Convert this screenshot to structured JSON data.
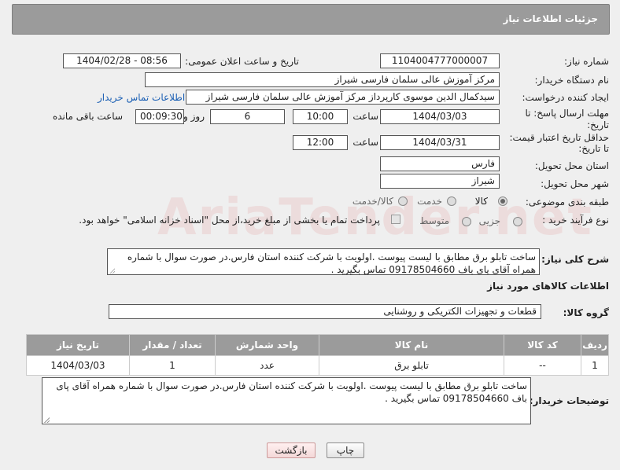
{
  "header": {
    "title": "جزئیات اطلاعات نیاز"
  },
  "form": {
    "need_number_label": "شماره نیاز:",
    "need_number": "1104004777000007",
    "announce_label": "تاریخ و ساعت اعلان عمومی:",
    "announce_value": "1404/02/28 - 08:56",
    "buyer_org_label": "نام دستگاه خریدار:",
    "buyer_org": "مرکز آموزش عالی سلمان فارسی شیراز",
    "creator_label": "ایجاد کننده درخواست:",
    "creator": "سیدکمال الدین موسوی کارپرداز مرکز آموزش عالی سلمان فارسی شیراز",
    "contact_link": "اطلاعات تماس خریدار",
    "deadline_label_1": "مهلت ارسال پاسخ: تا",
    "deadline_label_2": "تاریخ:",
    "deadline_date": "1404/03/03",
    "time_label": "ساعت",
    "deadline_time": "10:00",
    "days": "6",
    "days_label": "روز و",
    "remaining": "00:09:30",
    "remaining_label": "ساعت باقی مانده",
    "validity_label_1": "حداقل تاریخ اعتبار قیمت:",
    "validity_label_2": "تا تاریخ:",
    "validity_date": "1404/03/31",
    "validity_time": "12:00",
    "province_label": "استان محل تحویل:",
    "province": "فارس",
    "city_label": "شهر محل تحویل:",
    "city": "شیراز",
    "category_label": "طبقه بندی موضوعی:",
    "category_options": [
      "کالا",
      "خدمت",
      "کالا/خدمت"
    ],
    "process_label": "نوع فرآیند خرید :",
    "process_options": [
      "جزیی",
      "متوسط"
    ],
    "payment_note": "پرداخت تمام یا بخشی از مبلغ خرید،از محل \"اسناد خزانه اسلامی\" خواهد بود."
  },
  "description": {
    "label": "شرح کلی نیاز:",
    "text": "ساخت تابلو برق مطابق با لیست پیوست .اولویت با شرکت کننده استان فارس.در صورت سوال با شماره همراه آقای پای باف 09178504660 تماس بگیرید ."
  },
  "goods": {
    "section_title": "اطلاعات کالاهای مورد نیاز",
    "group_label": "گروه کالا:",
    "group_value": "قطعات و تجهیزات الکتریکی و روشنایی",
    "columns": [
      "ردیف",
      "کد کالا",
      "نام کالا",
      "واحد شمارش",
      "تعداد / مقدار",
      "تاریخ نیاز"
    ],
    "rows": [
      {
        "row": "1",
        "code": "--",
        "name": "تابلو برق",
        "unit": "عدد",
        "qty": "1",
        "date": "1404/03/03"
      }
    ]
  },
  "buyer_notes": {
    "label": "توضیحات خریدار:",
    "text": "ساخت تابلو برق مطابق با لیست پیوست .اولویت با شرکت کننده استان فارس.در صورت سوال با شماره همراه آقای پای باف 09178504660 تماس بگیرید ."
  },
  "buttons": {
    "print": "چاپ",
    "back": "بازگشت"
  },
  "watermark": "AriaTender.net"
}
